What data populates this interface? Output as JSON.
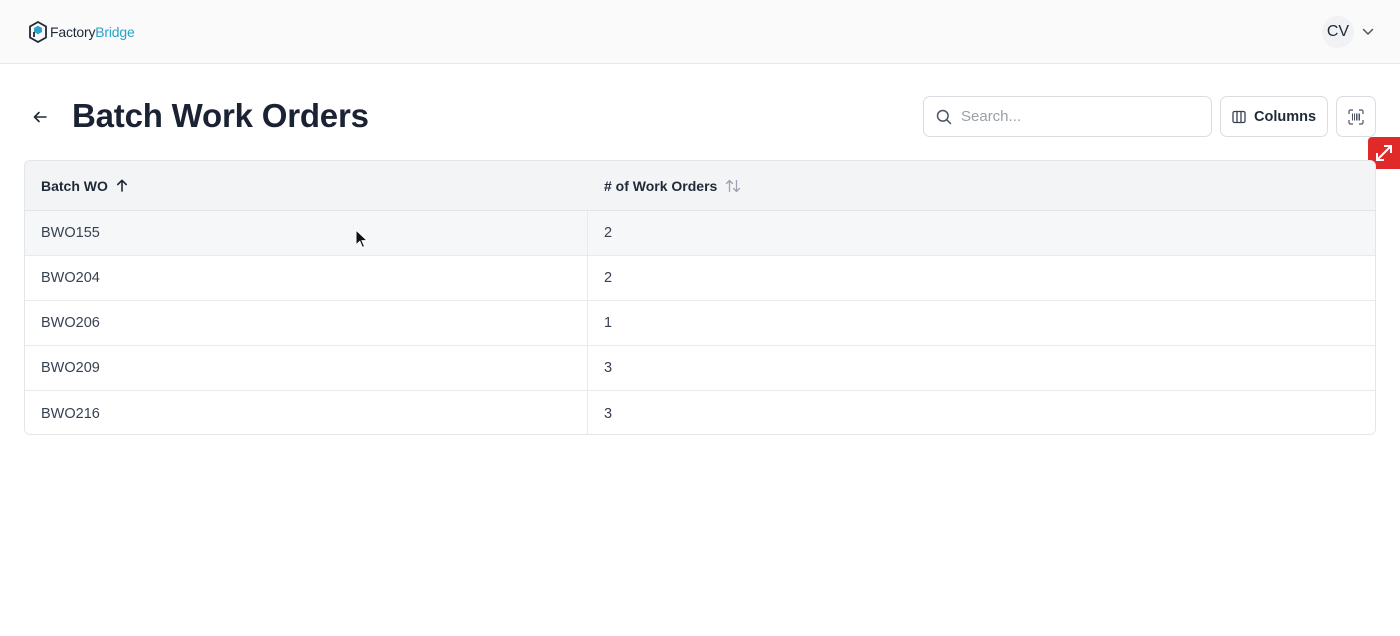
{
  "header": {
    "logo_part1": "Factory",
    "logo_part2": "Bridge",
    "user_initials": "CV",
    "brand_color": "#2aa3c8"
  },
  "page": {
    "title": "Batch Work Orders"
  },
  "toolbar": {
    "search_placeholder": "Search...",
    "search_value": "",
    "columns_label": "Columns"
  },
  "table": {
    "columns": [
      {
        "label": "Batch WO",
        "sort": "ascending"
      },
      {
        "label": "# of Work Orders",
        "sort": "none"
      }
    ],
    "rows": [
      {
        "batch_wo": "BWO155",
        "count": "2"
      },
      {
        "batch_wo": "BWO204",
        "count": "2"
      },
      {
        "batch_wo": "BWO206",
        "count": "1"
      },
      {
        "batch_wo": "BWO209",
        "count": "3"
      },
      {
        "batch_wo": "BWO216",
        "count": "3"
      }
    ]
  },
  "accent_red": "#e02a2a"
}
